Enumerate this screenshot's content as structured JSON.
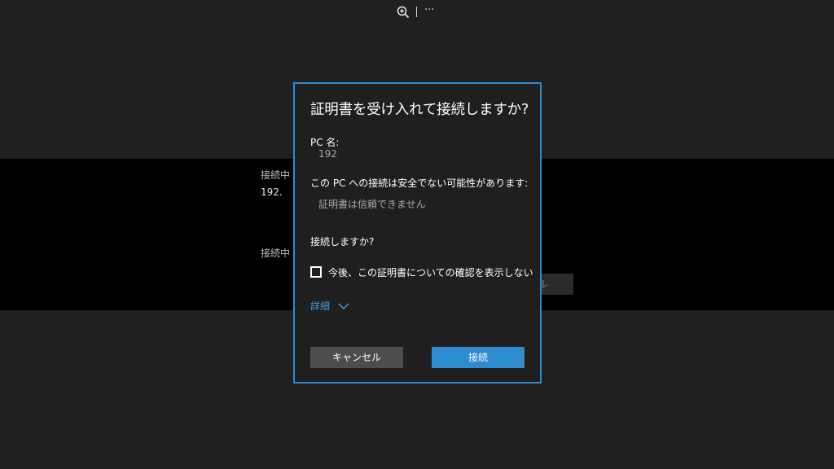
{
  "toolbar": {
    "zoom_icon": "zoom-in-icon",
    "more_label": "···"
  },
  "background": {
    "connecting_label_1": "接続中",
    "address_text": "192.",
    "connecting_label_2": "接続中",
    "button_fragment": "ル"
  },
  "dialog": {
    "title": "証明書を受け入れて接続しますか?",
    "pc_name_label": "PC 名:",
    "pc_name_value": "192",
    "warning_label": "この PC への接続は安全でない可能性があります:",
    "warning_value": "証明書は信頼できません",
    "question": "接続しますか?",
    "checkbox_label": "今後、この証明書についての確認を表示しない",
    "checkbox_checked": false,
    "details_label": "詳細",
    "cancel_label": "キャンセル",
    "connect_label": "接続",
    "accent_color": "#2d8bd0"
  }
}
